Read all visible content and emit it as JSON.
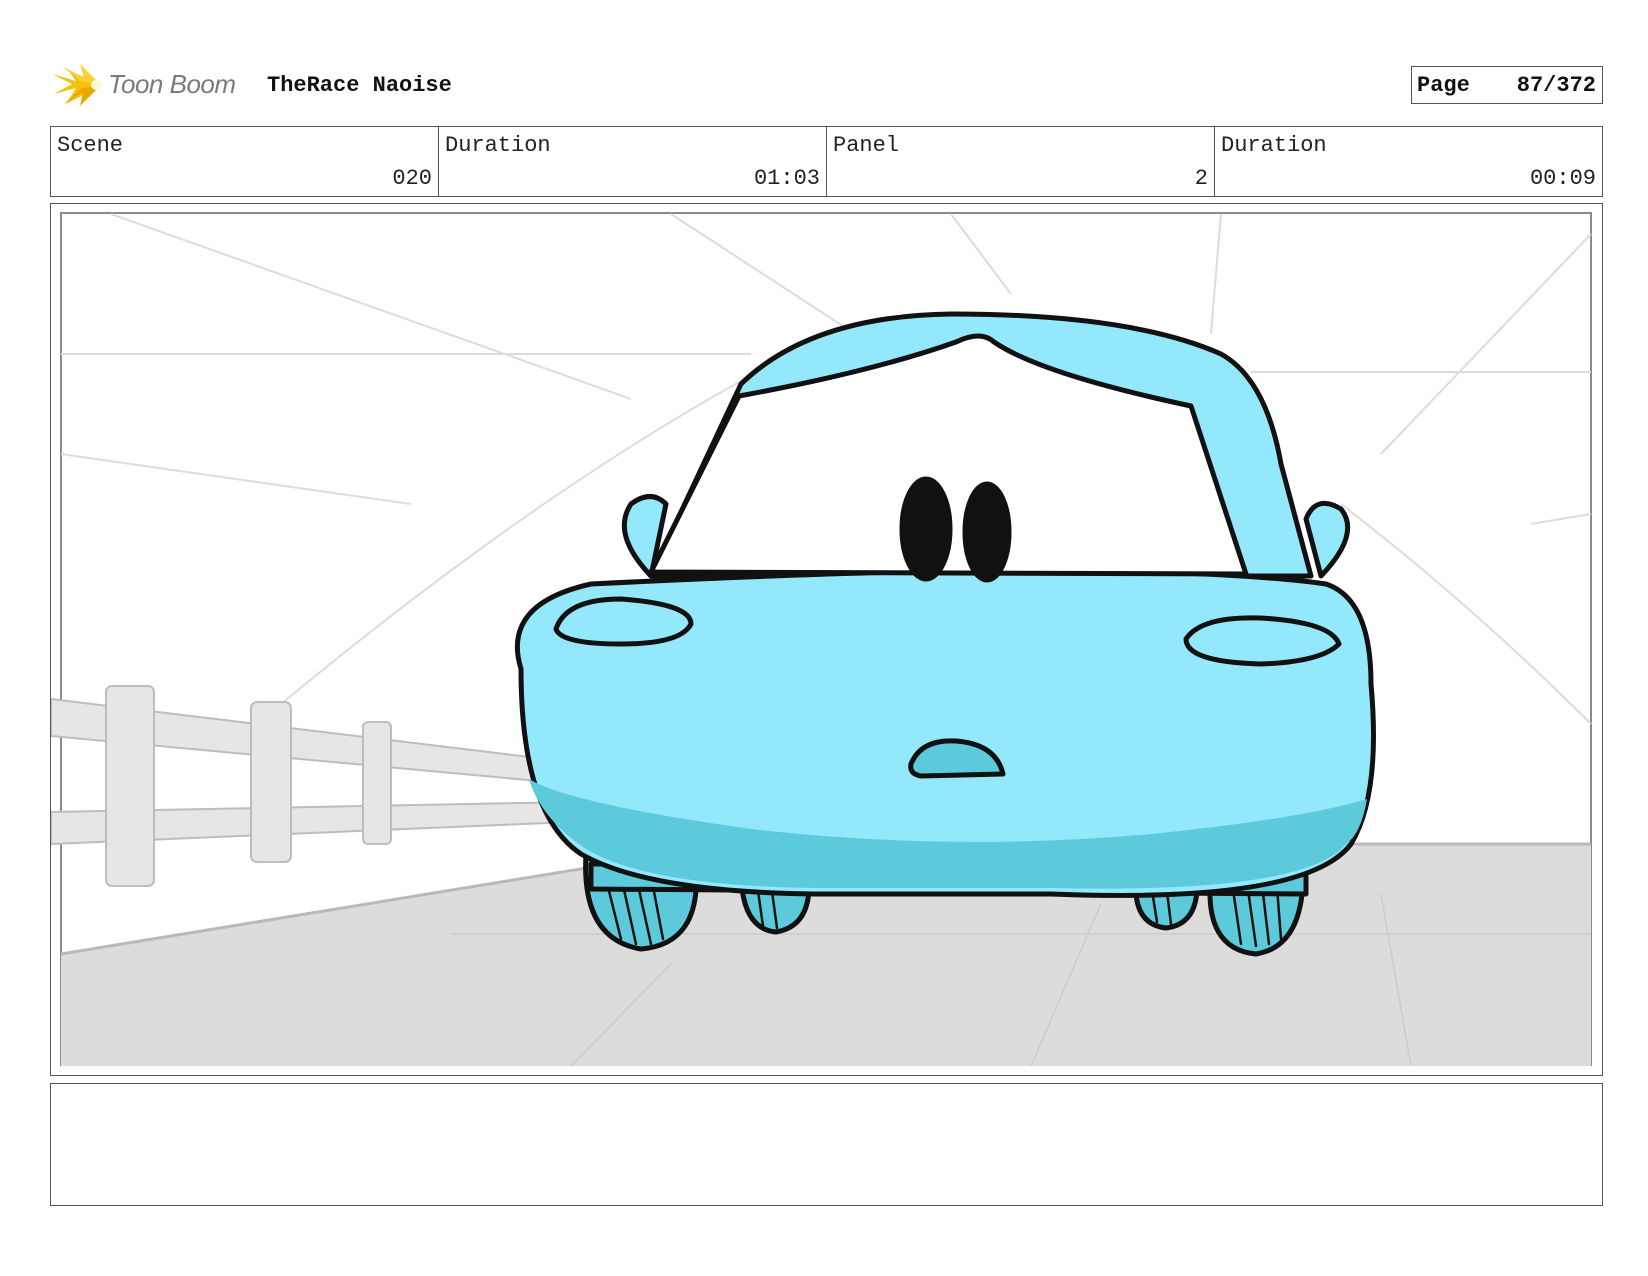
{
  "header": {
    "logo_text": "Toon Boom",
    "project_title": "TheRace Naoise",
    "page_label": "Page",
    "page_number": "87/372"
  },
  "info": {
    "scene_label": "Scene",
    "scene_value": "020",
    "scene_duration_label": "Duration",
    "scene_duration_value": "01:03",
    "panel_label": "Panel",
    "panel_value": "2",
    "panel_duration_label": "Duration",
    "panel_duration_value": "00:09"
  },
  "colors": {
    "car_body": "#93e9fb",
    "car_shadow": "#5ccadb",
    "road": "#dcdcdc",
    "sketch_lines": "#c8c8c8",
    "logo_star": "#f4c20d"
  },
  "notes": ""
}
